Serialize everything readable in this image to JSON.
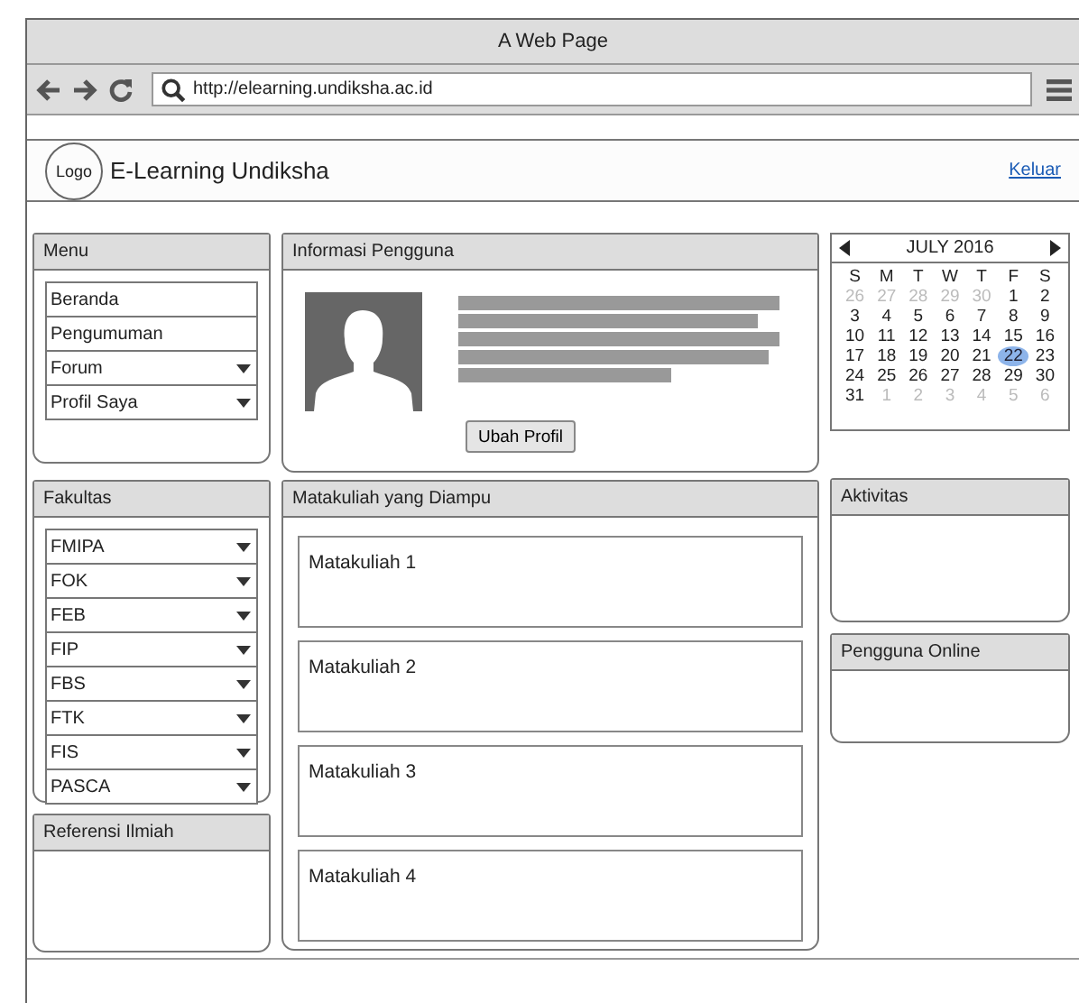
{
  "window": {
    "title": "A Web Page"
  },
  "browser": {
    "url": "http://elearning.undiksha.ac.id"
  },
  "header": {
    "logo": "Logo",
    "site_name": "E-Learning Undiksha",
    "logout_link": "Keluar"
  },
  "menu": {
    "title": "Menu",
    "items": [
      {
        "label": "Beranda",
        "kind": "link"
      },
      {
        "label": "Pengumuman",
        "kind": "link"
      },
      {
        "label": "Forum",
        "kind": "dropdown"
      },
      {
        "label": "Profil Saya",
        "kind": "dropdown"
      }
    ]
  },
  "faculties": {
    "title": "Fakultas",
    "items": [
      {
        "label": "FMIPA",
        "kind": "dropdown"
      },
      {
        "label": "FOK",
        "kind": "dropdown"
      },
      {
        "label": "FEB",
        "kind": "dropdown"
      },
      {
        "label": "FIP",
        "kind": "dropdown"
      },
      {
        "label": "FBS",
        "kind": "dropdown"
      },
      {
        "label": "FTK",
        "kind": "dropdown"
      },
      {
        "label": "FIS",
        "kind": "dropdown"
      },
      {
        "label": "PASCA",
        "kind": "dropdown"
      }
    ]
  },
  "references": {
    "title": "Referensi Ilmiah"
  },
  "user_info": {
    "title": "Informasi Pengguna",
    "edit_button": "Ubah Profil"
  },
  "courses": {
    "title": "Matakuliah yang Diampu",
    "items": [
      "Matakuliah 1",
      "Matakuliah 2",
      "Matakuliah 3",
      "Matakuliah 4"
    ]
  },
  "calendar": {
    "month": "JULY 2016",
    "weekdays": [
      "S",
      "M",
      "T",
      "W",
      "T",
      "F",
      "S"
    ],
    "days": [
      {
        "label": "26",
        "other_month": true,
        "selected": false
      },
      {
        "label": "27",
        "other_month": true,
        "selected": false
      },
      {
        "label": "28",
        "other_month": true,
        "selected": false
      },
      {
        "label": "29",
        "other_month": true,
        "selected": false
      },
      {
        "label": "30",
        "other_month": true,
        "selected": false
      },
      {
        "label": "1",
        "other_month": false,
        "selected": false
      },
      {
        "label": "2",
        "other_month": false,
        "selected": false
      },
      {
        "label": "3",
        "other_month": false,
        "selected": false
      },
      {
        "label": "4",
        "other_month": false,
        "selected": false
      },
      {
        "label": "5",
        "other_month": false,
        "selected": false
      },
      {
        "label": "6",
        "other_month": false,
        "selected": false
      },
      {
        "label": "7",
        "other_month": false,
        "selected": false
      },
      {
        "label": "8",
        "other_month": false,
        "selected": false
      },
      {
        "label": "9",
        "other_month": false,
        "selected": false
      },
      {
        "label": "10",
        "other_month": false,
        "selected": false
      },
      {
        "label": "11",
        "other_month": false,
        "selected": false
      },
      {
        "label": "12",
        "other_month": false,
        "selected": false
      },
      {
        "label": "13",
        "other_month": false,
        "selected": false
      },
      {
        "label": "14",
        "other_month": false,
        "selected": false
      },
      {
        "label": "15",
        "other_month": false,
        "selected": false
      },
      {
        "label": "16",
        "other_month": false,
        "selected": false
      },
      {
        "label": "17",
        "other_month": false,
        "selected": false
      },
      {
        "label": "18",
        "other_month": false,
        "selected": false
      },
      {
        "label": "19",
        "other_month": false,
        "selected": false
      },
      {
        "label": "20",
        "other_month": false,
        "selected": false
      },
      {
        "label": "21",
        "other_month": false,
        "selected": false
      },
      {
        "label": "22",
        "other_month": false,
        "selected": true
      },
      {
        "label": "23",
        "other_month": false,
        "selected": false
      },
      {
        "label": "24",
        "other_month": false,
        "selected": false
      },
      {
        "label": "25",
        "other_month": false,
        "selected": false
      },
      {
        "label": "26",
        "other_month": false,
        "selected": false
      },
      {
        "label": "27",
        "other_month": false,
        "selected": false
      },
      {
        "label": "28",
        "other_month": false,
        "selected": false
      },
      {
        "label": "29",
        "other_month": false,
        "selected": false
      },
      {
        "label": "30",
        "other_month": false,
        "selected": false
      },
      {
        "label": "31",
        "other_month": false,
        "selected": false
      },
      {
        "label": "1",
        "other_month": true,
        "selected": false
      },
      {
        "label": "2",
        "other_month": true,
        "selected": false
      },
      {
        "label": "3",
        "other_month": true,
        "selected": false
      },
      {
        "label": "4",
        "other_month": true,
        "selected": false
      },
      {
        "label": "5",
        "other_month": true,
        "selected": false
      },
      {
        "label": "6",
        "other_month": true,
        "selected": false
      }
    ]
  },
  "activities": {
    "title": "Aktivitas"
  },
  "online_users": {
    "title": "Pengguna Online"
  }
}
